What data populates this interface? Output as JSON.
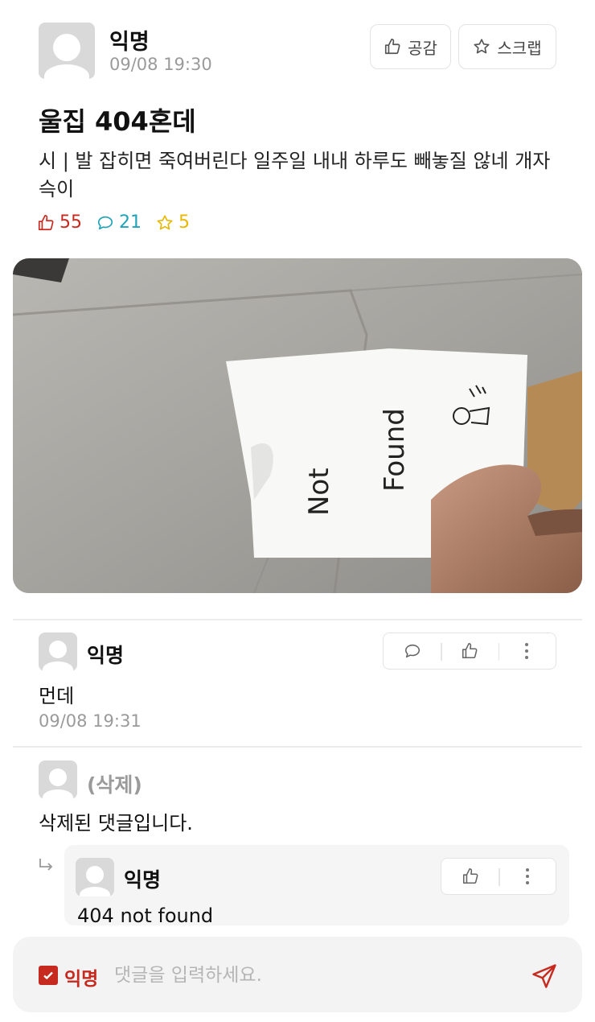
{
  "post": {
    "author": "익명",
    "time": "09/08 19:30",
    "like_label": "공감",
    "scrap_label": "스크랩",
    "title": "울집 404혼데",
    "body": "시 | 발 잡히면 죽여버린다 일주일 내내 하루도 빼놓질 않네 개자슥이",
    "stats": {
      "likes": "55",
      "comments": "21",
      "scraps": "5"
    },
    "photo": {
      "note_word_1": "Not",
      "note_word_2": "Found"
    }
  },
  "comments": [
    {
      "author": "익명",
      "text": "먼데",
      "time": "09/08 19:31"
    },
    {
      "author": "(삭제)",
      "text": "삭제된 댓글입니다."
    }
  ],
  "reply": {
    "author": "익명",
    "text": "404 not found"
  },
  "input_bar": {
    "anon_label": "익명",
    "placeholder": "댓글을 입력하세요."
  },
  "colors": {
    "like": "#c62a1f",
    "comment": "#1fa3b8",
    "scrap": "#e8b800",
    "accent": "#c62a1f"
  },
  "icons": [
    "thumbs-up-icon",
    "star-icon",
    "comment-bubble-icon",
    "more-vertical-icon",
    "reply-arrow-icon",
    "checkbox-checked-icon",
    "send-icon"
  ]
}
